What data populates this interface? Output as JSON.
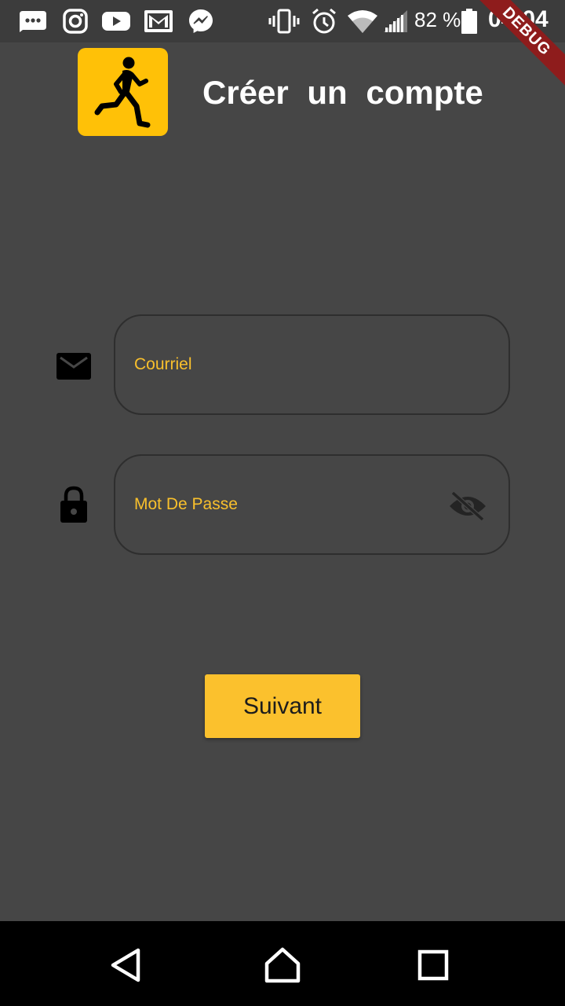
{
  "status_bar": {
    "icons_left": [
      "messages-icon",
      "instagram-icon",
      "youtube-icon",
      "gmail-icon",
      "messenger-icon"
    ],
    "icons_right": [
      "vibrate-icon",
      "alarm-icon",
      "wifi-icon",
      "signal-icon",
      "battery-icon"
    ],
    "battery_text": "82 %",
    "time": "04:04"
  },
  "debug_banner": "DEBUG",
  "header": {
    "logo": "running-man-logo",
    "title": "Créer un compte"
  },
  "form": {
    "email": {
      "icon": "mail-icon",
      "placeholder": "Courriel",
      "value": ""
    },
    "password": {
      "icon": "lock-icon",
      "placeholder": "Mot De Passe",
      "value": "",
      "toggle_icon": "visibility-off-icon"
    },
    "submit_label": "Suivant"
  },
  "nav_bar": {
    "buttons": [
      "back-icon",
      "home-icon",
      "recents-icon"
    ]
  },
  "colors": {
    "background": "#464646",
    "status_bar": "#3c3c3c",
    "accent": "#fbc12d",
    "placeholder": "#f9c02c",
    "debug_ribbon": "#8e1c1c"
  }
}
